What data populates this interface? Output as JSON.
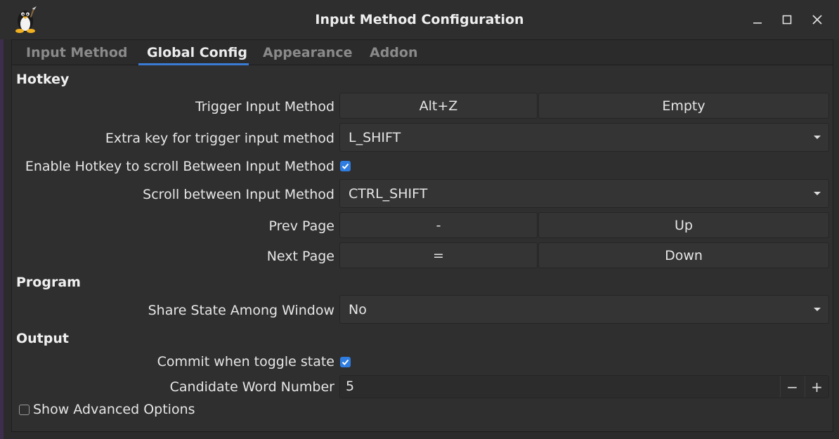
{
  "window": {
    "title": "Input Method Configuration"
  },
  "tabs": [
    {
      "label": "Input Method"
    },
    {
      "label": "Global Config"
    },
    {
      "label": "Appearance"
    },
    {
      "label": "Addon"
    }
  ],
  "hotkey": {
    "section": "Hotkey",
    "trigger": {
      "label": "Trigger Input Method",
      "key1": "Alt+Z",
      "key2": "Empty"
    },
    "extra_key": {
      "label": "Extra key for trigger input method",
      "value": "L_SHIFT"
    },
    "enable_scroll": {
      "label": "Enable Hotkey to scroll Between Input Method",
      "checked": true
    },
    "scroll": {
      "label": "Scroll between Input Method",
      "value": "CTRL_SHIFT"
    },
    "prev_page": {
      "label": "Prev Page",
      "key1": "-",
      "key2": "Up"
    },
    "next_page": {
      "label": "Next Page",
      "key1": "=",
      "key2": "Down"
    }
  },
  "program": {
    "section": "Program",
    "share_state": {
      "label": "Share State Among Window",
      "value": "No"
    }
  },
  "output": {
    "section": "Output",
    "commit_toggle": {
      "label": "Commit when toggle state",
      "checked": true
    },
    "candidate": {
      "label": "Candidate Word Number",
      "value": "5",
      "minus": "−",
      "plus": "+"
    }
  },
  "advanced": {
    "label": "Show Advanced Options",
    "checked": false
  },
  "colors": {
    "accent": "#3a7bd5",
    "checkbox": "#2f7de1",
    "background": "#2f2f2f"
  }
}
